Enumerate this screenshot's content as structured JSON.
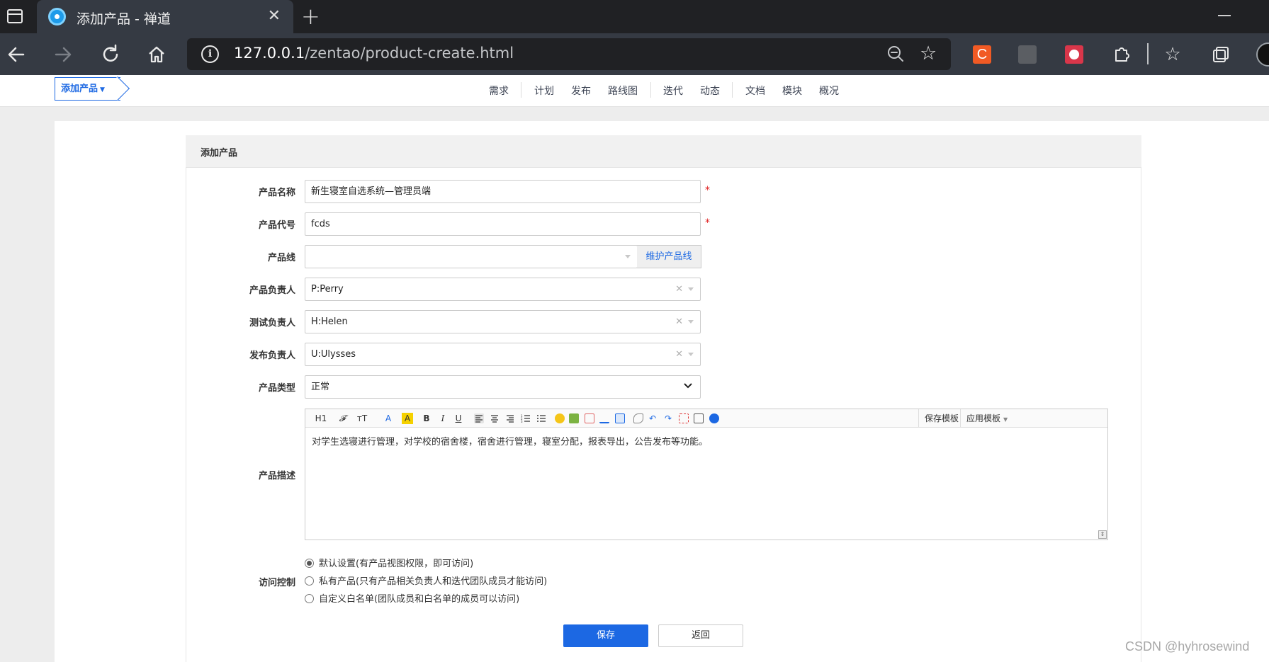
{
  "browser": {
    "tab_title": "添加产品 - 禅道",
    "tab_close": "✕",
    "new_tab": "+",
    "url_host": "127.0.0.1",
    "url_path": "/zentao/product-create.html",
    "extension_c_label": "C"
  },
  "header": {
    "breadcrumb": "添加产品",
    "nav_items": [
      "需求",
      "计划",
      "发布",
      "路线图",
      "迭代",
      "动态",
      "文档",
      "模块",
      "概况"
    ]
  },
  "form": {
    "title": "添加产品",
    "required_mark": "*",
    "fields": {
      "name": {
        "label": "产品名称",
        "value": "新生寝室自选系统—管理员端"
      },
      "code": {
        "label": "产品代号",
        "value": "fcds"
      },
      "line": {
        "label": "产品线",
        "value": "",
        "addon": "维护产品线"
      },
      "po": {
        "label": "产品负责人",
        "value": "P:Perry"
      },
      "qd": {
        "label": "测试负责人",
        "value": "H:Helen"
      },
      "rd": {
        "label": "发布负责人",
        "value": "U:Ulysses"
      },
      "type": {
        "label": "产品类型",
        "value": "正常"
      },
      "desc": {
        "label": "产品描述",
        "value": "对学生选寝进行管理，对学校的宿舍楼，宿舍进行管理，寝室分配，报表导出，公告发布等功能。"
      },
      "acl": {
        "label": "访问控制",
        "options": [
          {
            "label": "默认设置(有产品视图权限，即可访问)",
            "checked": true
          },
          {
            "label": "私有产品(只有产品相关负责人和迭代团队成员才能访问)",
            "checked": false
          },
          {
            "label": "自定义白名单(团队成员和白名单的成员可以访问)",
            "checked": false
          }
        ]
      }
    },
    "editor_toolbar": {
      "heading": "H1",
      "font": "𝓕",
      "size": "тT",
      "font_color": "A",
      "bg_color": "A",
      "bold": "B",
      "italic": "I",
      "underline": "U",
      "save_template": "保存模板",
      "apply_template": "应用模板"
    },
    "buttons": {
      "save": "保存",
      "back": "返回"
    }
  },
  "colors": {
    "accent": "#1c68e3",
    "required": "#e02020",
    "chrome_dark": "#202124",
    "chrome_mid": "#353a43"
  },
  "watermark": "CSDN @hyhrosewind"
}
